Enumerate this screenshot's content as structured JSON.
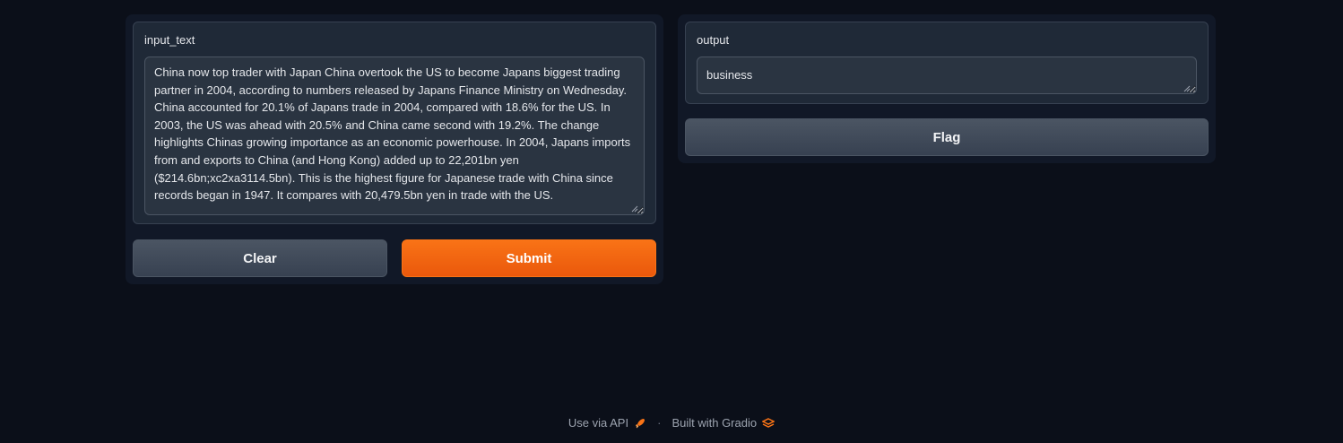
{
  "input": {
    "label": "input_text",
    "value": "China now top trader with Japan China overtook the US to become Japans biggest trading partner in 2004, according to numbers released by Japans Finance Ministry on Wednesday. China accounted for 20.1% of Japans trade in 2004, compared with 18.6% for the US. In 2003, the US was ahead with 20.5% and China came second with 19.2%. The change highlights Chinas growing importance as an economic powerhouse. In 2004, Japans imports from and exports to China (and Hong Kong) added up to 22,201bn yen ($214.6bn;xc2xa3114.5bn). This is the highest figure for Japanese trade with China since records began in 1947. It compares with 20,479.5bn yen in trade with the US."
  },
  "buttons": {
    "clear_label": "Clear",
    "submit_label": "Submit",
    "flag_label": "Flag"
  },
  "output": {
    "label": "output",
    "value": "business"
  },
  "footer": {
    "api_label": "Use via API",
    "separator": "·",
    "built_label": "Built with Gradio"
  },
  "colors": {
    "background": "#0b0f19",
    "panel": "#111827",
    "accent": "#f97316"
  },
  "icons": {
    "api": "rocket-icon",
    "gradio": "gradio-logo-icon"
  }
}
